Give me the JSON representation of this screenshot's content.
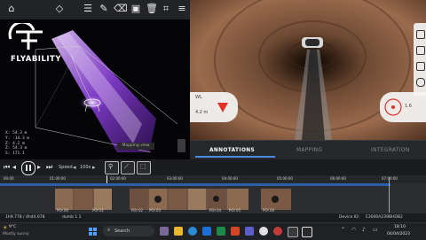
{
  "brand": {
    "name": "FLYABILITY"
  },
  "viewer": {
    "readout": [
      "X: 54.3 m",
      "Y: -14.3 m",
      "Z: 4.2 m",
      "Z: 54.3 m",
      "S: 171.1"
    ],
    "tooltip": "Mapping view"
  },
  "camera": {
    "left_panel_label": "WL",
    "left_panel_value": "4.2 m",
    "right_panel_value": "1.6"
  },
  "tabs": [
    {
      "label": "ANNOTATIONS",
      "active": true
    },
    {
      "label": "MAPPING",
      "active": false
    },
    {
      "label": "INTEGRATION",
      "active": false
    }
  ],
  "playback": {
    "speed_label": "Speed",
    "speed_value": "100x"
  },
  "timeline": {
    "ruler": [
      "00:00",
      "01:00:00",
      "02:00:00",
      "03:00:00",
      "04:00:00",
      "05:00:00",
      "06:00:00",
      "07:00:00"
    ],
    "thumb_labels": [
      "POI 00",
      "POI 01",
      "POI 02",
      "POI 03",
      "POI 04",
      "POI 05",
      "POI 06"
    ]
  },
  "status": {
    "left": "1h9.778 / 4h44.678",
    "center": "dumb 1 1",
    "device_label": "Device ID:",
    "device_id": "E3000A239BHDB2"
  },
  "taskbar": {
    "weather_temp": "9°C",
    "weather_desc": "Mostly sunny",
    "search": "Search",
    "time": "18:10",
    "date": "04/04/2023"
  },
  "colors": {
    "accent": "#2d5fa8",
    "viewer_glow": "#b35cff",
    "alert": "#e0302a"
  }
}
